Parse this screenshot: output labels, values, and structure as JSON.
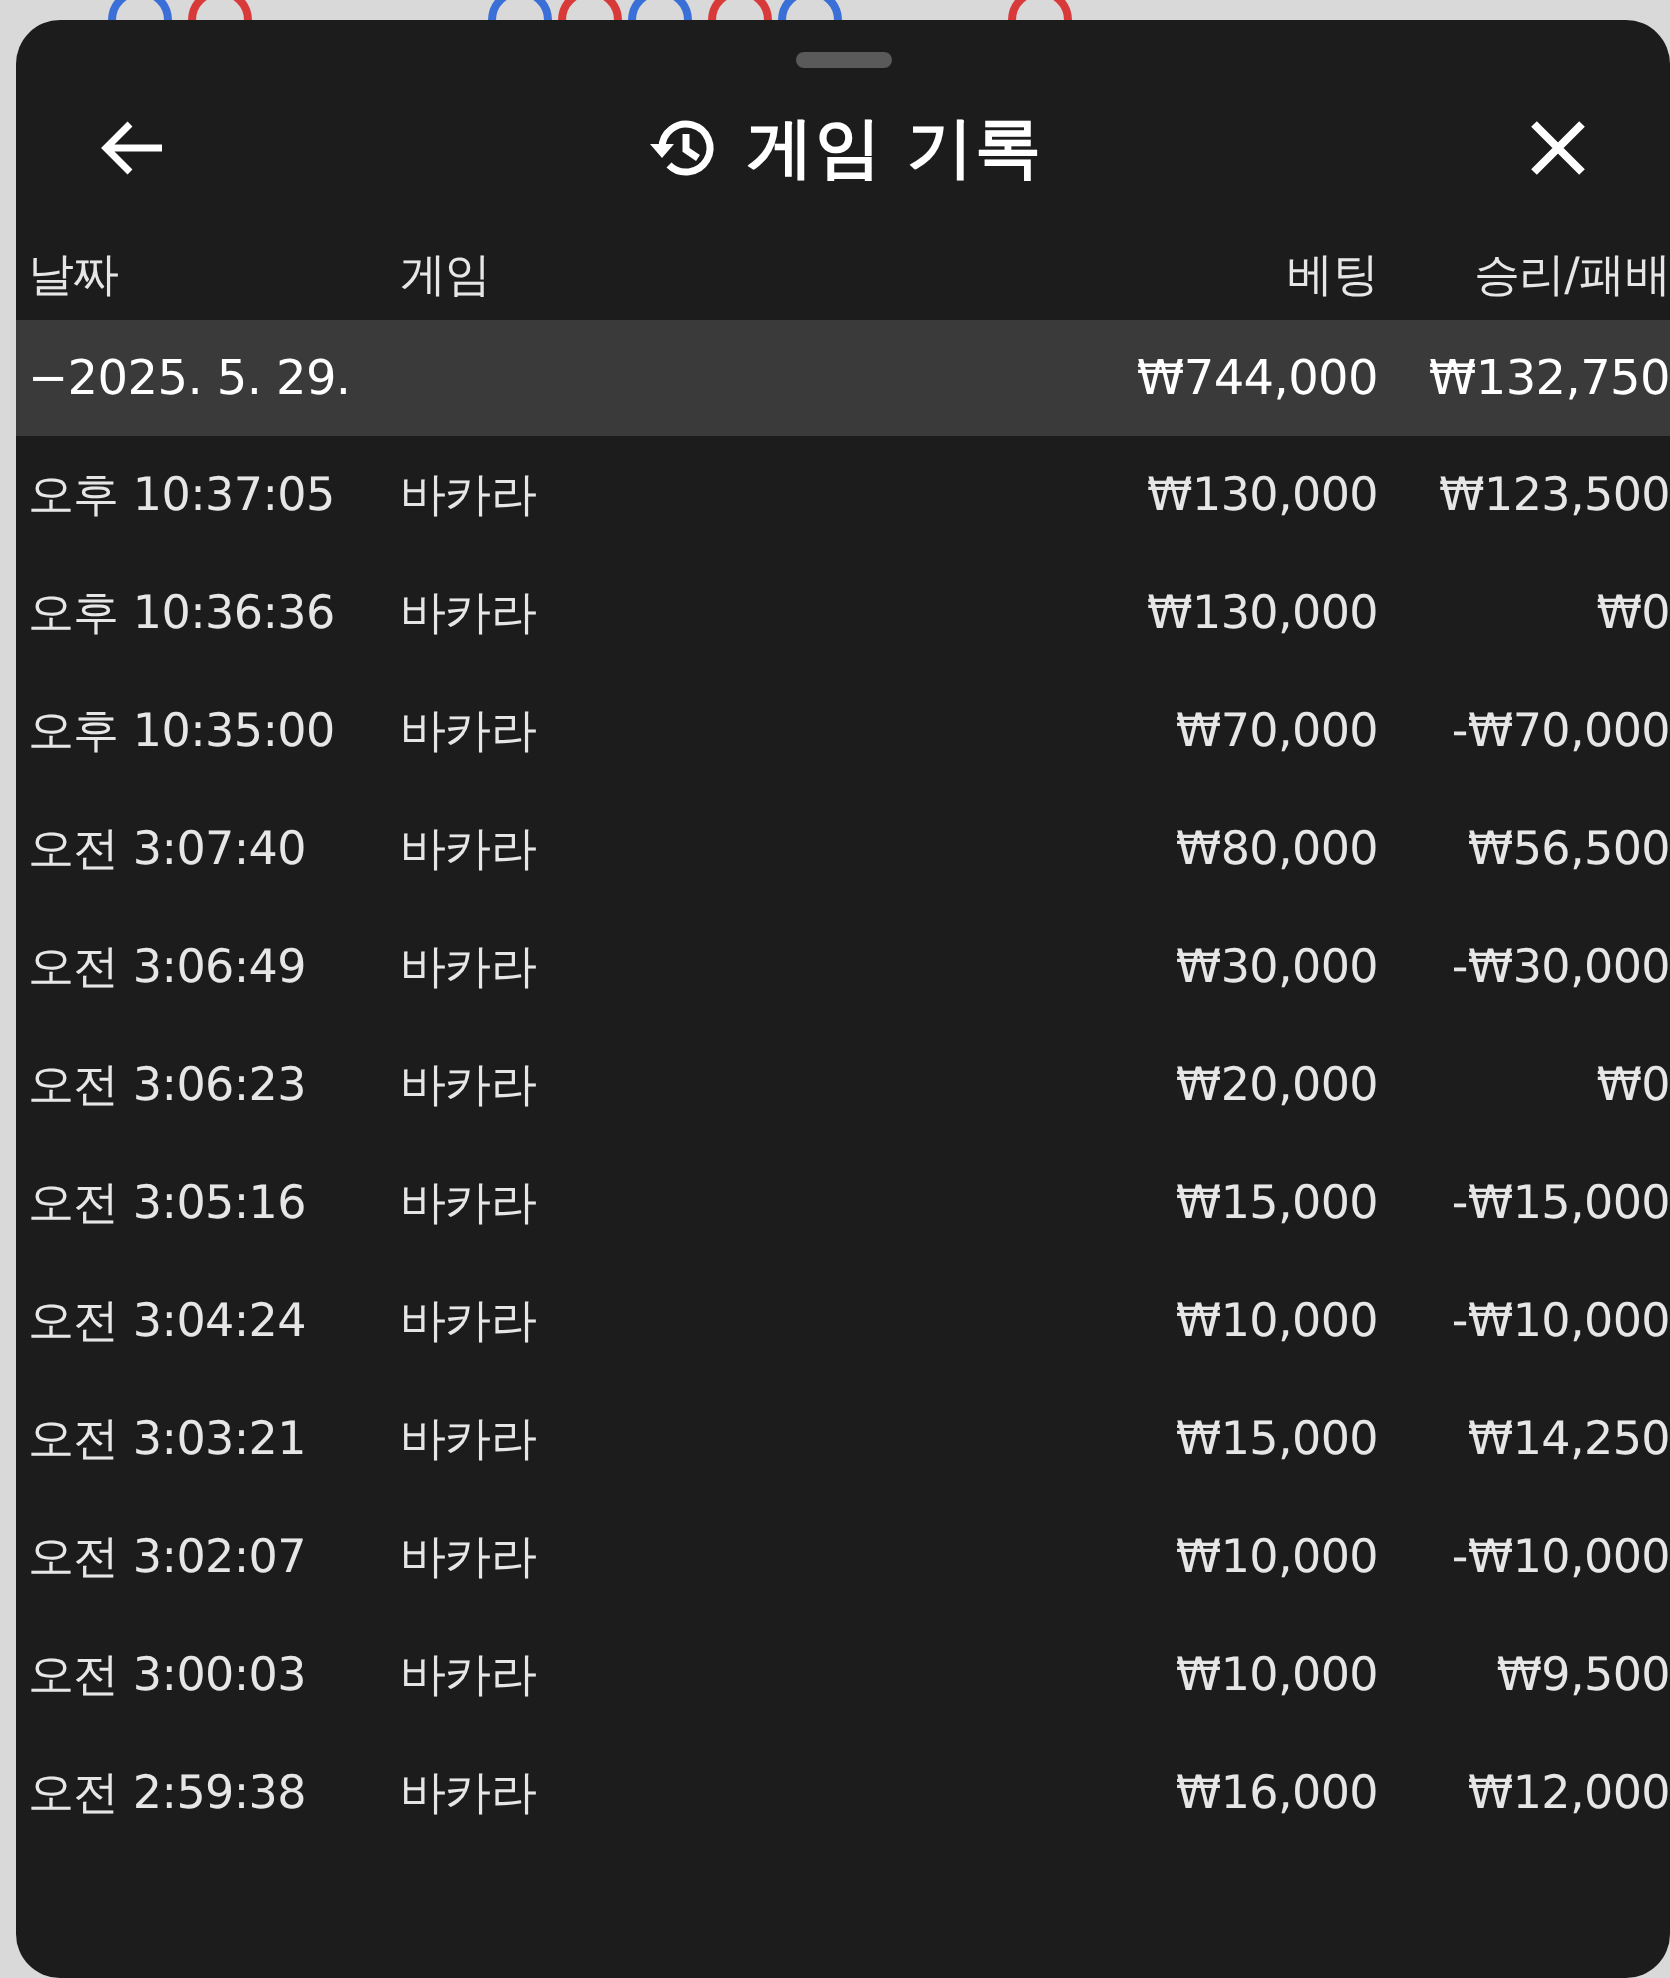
{
  "sheet": {
    "title": "게임 기록"
  },
  "table": {
    "columns": [
      "날짜",
      "게임",
      "베팅",
      "승리/패배"
    ],
    "group": {
      "date": "−2025. 5. 29.",
      "bet": "₩744,000",
      "result": "₩132,750"
    },
    "rows": [
      {
        "time": "오후 10:37:05",
        "game": "바카라",
        "bet": "₩130,000",
        "result": "₩123,500"
      },
      {
        "time": "오후 10:36:36",
        "game": "바카라",
        "bet": "₩130,000",
        "result": "₩0"
      },
      {
        "time": "오후 10:35:00",
        "game": "바카라",
        "bet": "₩70,000",
        "result": "-₩70,000"
      },
      {
        "time": "오전 3:07:40",
        "game": "바카라",
        "bet": "₩80,000",
        "result": "₩56,500"
      },
      {
        "time": "오전 3:06:49",
        "game": "바카라",
        "bet": "₩30,000",
        "result": "-₩30,000"
      },
      {
        "time": "오전 3:06:23",
        "game": "바카라",
        "bet": "₩20,000",
        "result": "₩0"
      },
      {
        "time": "오전 3:05:16",
        "game": "바카라",
        "bet": "₩15,000",
        "result": "-₩15,000"
      },
      {
        "time": "오전 3:04:24",
        "game": "바카라",
        "bet": "₩10,000",
        "result": "-₩10,000"
      },
      {
        "time": "오전 3:03:21",
        "game": "바카라",
        "bet": "₩15,000",
        "result": "₩14,250"
      },
      {
        "time": "오전 3:02:07",
        "game": "바카라",
        "bet": "₩10,000",
        "result": "-₩10,000"
      },
      {
        "time": "오전 3:00:03",
        "game": "바카라",
        "bet": "₩10,000",
        "result": "₩9,500"
      },
      {
        "time": "오전 2:59:38",
        "game": "바카라",
        "bet": "₩16,000",
        "result": "₩12,000"
      }
    ]
  }
}
